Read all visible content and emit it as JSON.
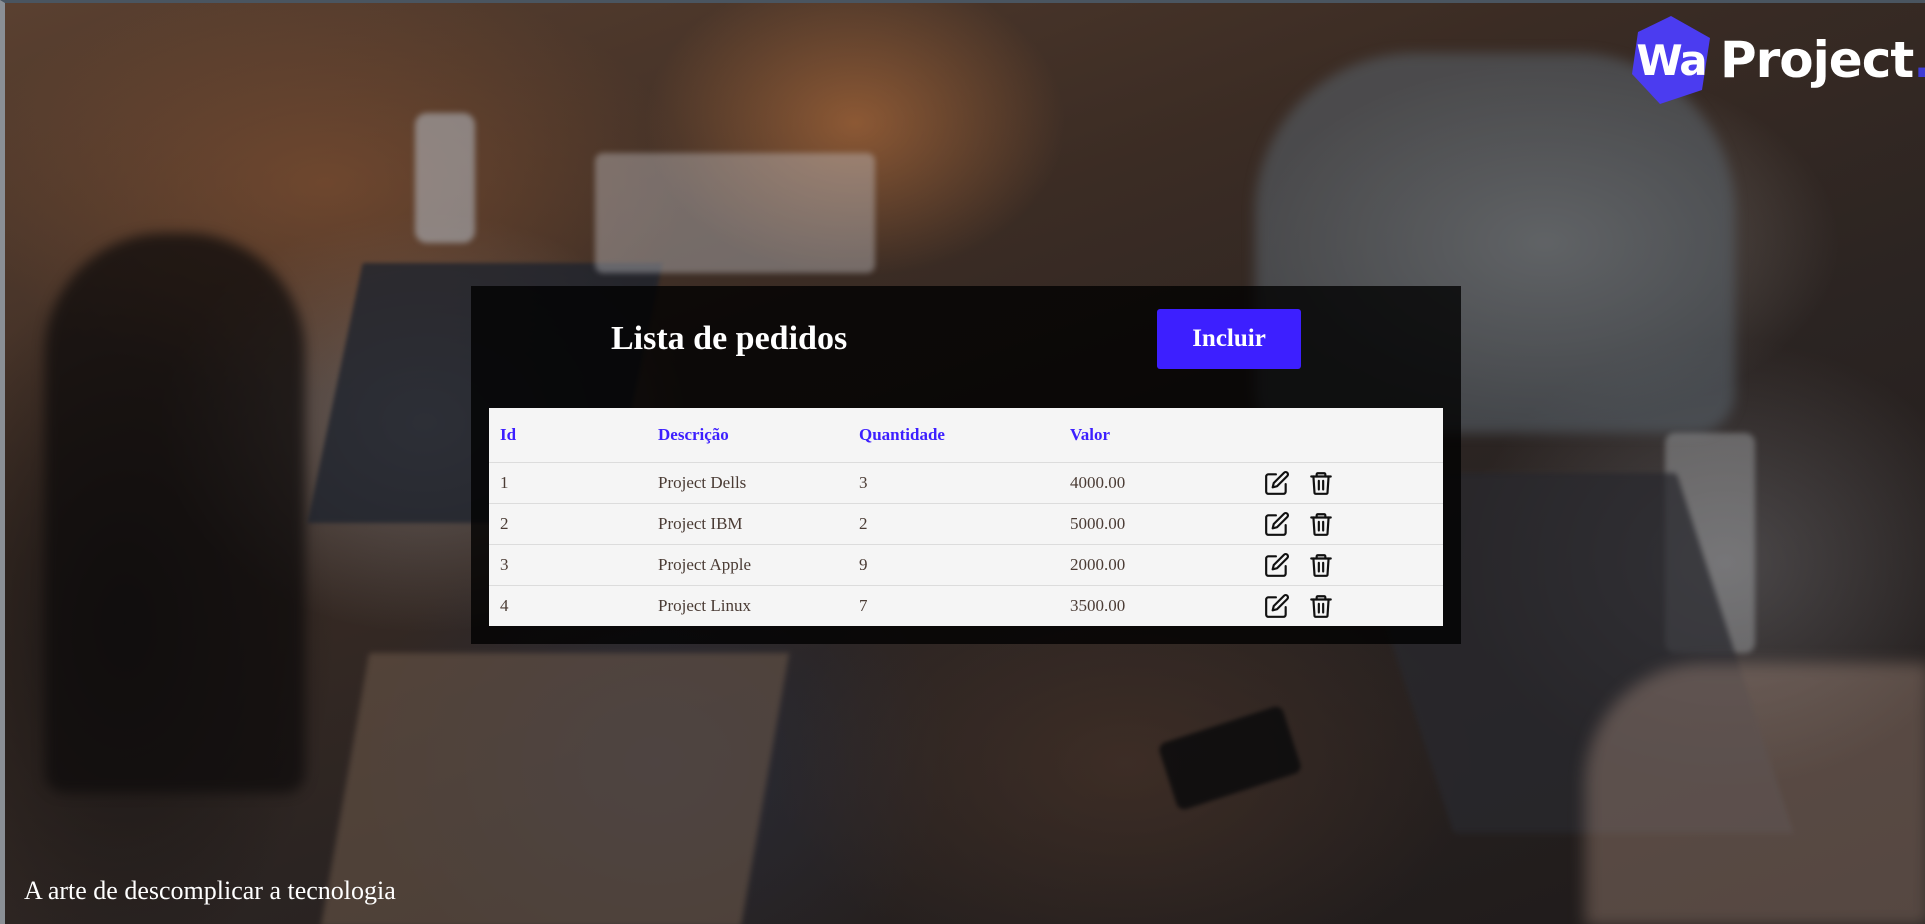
{
  "brand": {
    "logo_mark": "Wa",
    "logo_word": "Project",
    "logo_dot": ".",
    "accent_color": "#3d1fff"
  },
  "panel": {
    "title": "Lista de pedidos",
    "add_button_label": "Incluir"
  },
  "table": {
    "headers": {
      "id": "Id",
      "descricao": "Descrição",
      "quantidade": "Quantidade",
      "valor": "Valor"
    },
    "rows": [
      {
        "id": "1",
        "descricao": "Project Dells",
        "quantidade": "3",
        "valor": "4000.00",
        "edit_icon": "edit-icon",
        "delete_icon": "trash-icon"
      },
      {
        "id": "2",
        "descricao": "Project IBM",
        "quantidade": "2",
        "valor": "5000.00",
        "edit_icon": "edit-icon",
        "delete_icon": "trash-icon"
      },
      {
        "id": "3",
        "descricao": "Project Apple",
        "quantidade": "9",
        "valor": "2000.00",
        "edit_icon": "edit-icon",
        "delete_icon": "trash-icon"
      },
      {
        "id": "4",
        "descricao": "Project Linux",
        "quantidade": "7",
        "valor": "3500.00",
        "edit_icon": "edit-icon",
        "delete_icon": "trash-icon"
      }
    ]
  },
  "footer": {
    "tagline": "A arte de descomplicar a tecnologia"
  }
}
